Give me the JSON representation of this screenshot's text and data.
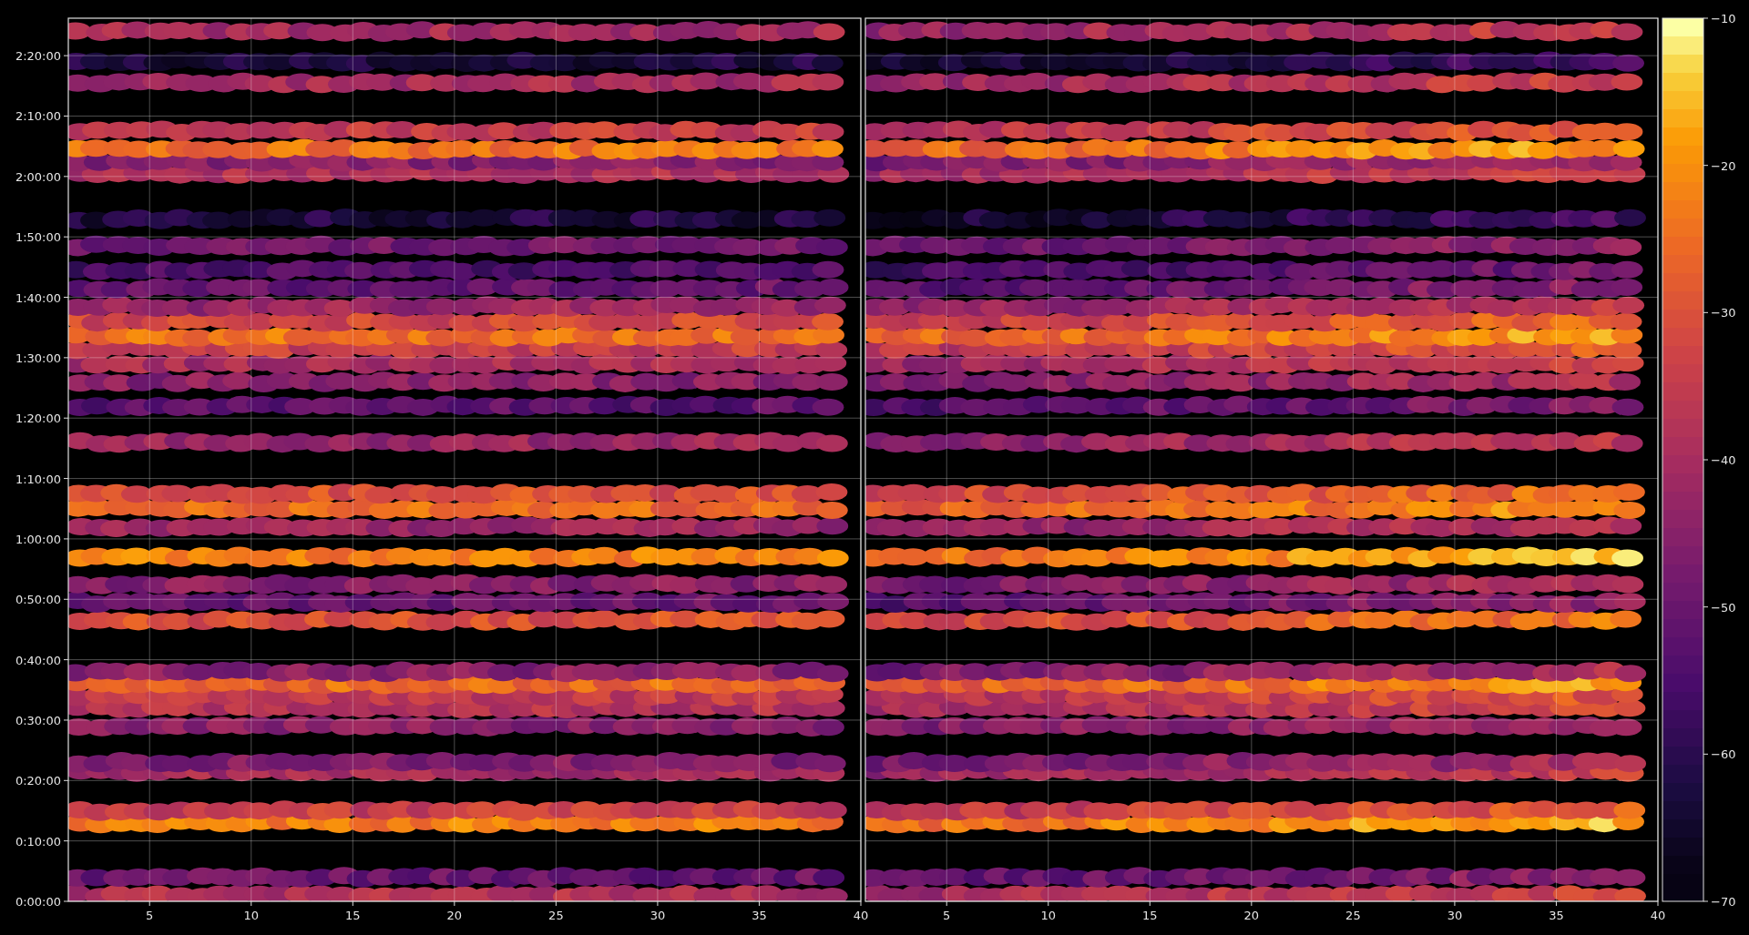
{
  "left_plot": {
    "yticks": [
      "2:20:00",
      "2:10:00",
      "2:00:00",
      "1:50:00",
      "1:40:00",
      "1:30:00",
      "1:20:00",
      "1:10:00",
      "1:00:00",
      "0:50:00",
      "0:40:00",
      "0:30:00",
      "0:20:00",
      "0:10:00",
      "0:00:00"
    ],
    "xticks": [
      "5",
      "10",
      "15",
      "20",
      "25",
      "30",
      "35",
      "40"
    ]
  },
  "right_plot": {
    "xticks": [
      "5",
      "10",
      "15",
      "20",
      "25",
      "30",
      "35",
      "40"
    ]
  },
  "colorbar": {
    "ticks": [
      "−10",
      "−20",
      "−30",
      "−40",
      "−50",
      "−60",
      "−70"
    ]
  }
}
